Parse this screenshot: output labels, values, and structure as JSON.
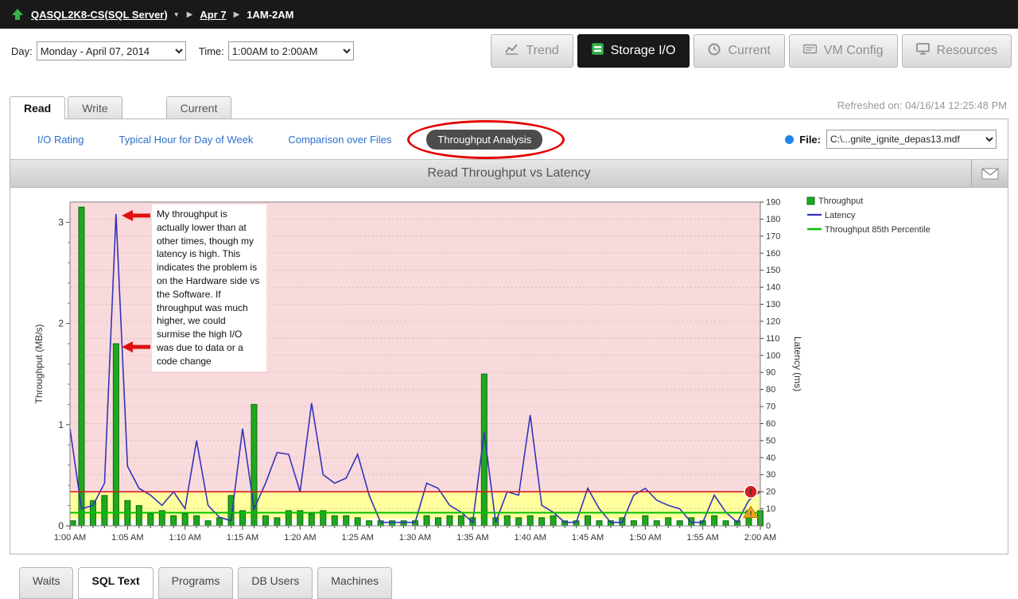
{
  "topbar": {
    "server": "QASQL2K8-CS(SQL Server)",
    "date": "Apr 7",
    "time_range": "1AM-2AM"
  },
  "toolbar": {
    "day_label": "Day:",
    "day_value": "Monday - April 07, 2014",
    "time_label": "Time:",
    "time_value": "1:00AM to 2:00AM",
    "nav": [
      {
        "label": "Trend"
      },
      {
        "label": "Storage I/O"
      },
      {
        "label": "Current"
      },
      {
        "label": "VM Config"
      },
      {
        "label": "Resources"
      }
    ]
  },
  "tabs": {
    "read": "Read",
    "write": "Write",
    "current": "Current",
    "refreshed": "Refreshed on: 04/16/14 12:25:48 PM"
  },
  "subnav": {
    "links": [
      {
        "label": "I/O Rating"
      },
      {
        "label": "Typical Hour for Day of Week"
      },
      {
        "label": "Comparison over Files"
      }
    ],
    "active_link": "Throughput Analysis",
    "file_label": "File:",
    "file_value": "C:\\...gnite_ignite_depas13.mdf"
  },
  "chart_data": {
    "type": "bar",
    "title": "Read Throughput vs Latency",
    "x_tick_labels": [
      "1:00 AM",
      "1:05 AM",
      "1:10 AM",
      "1:15 AM",
      "1:20 AM",
      "1:25 AM",
      "1:30 AM",
      "1:35 AM",
      "1:40 AM",
      "1:45 AM",
      "1:50 AM",
      "1:55 AM",
      "2:00 AM"
    ],
    "left_axis": {
      "label": "Throughput (MB/s)",
      "min": 0,
      "max": 3.2,
      "ticks": [
        0,
        1,
        2,
        3
      ],
      "minor_step": 0.2
    },
    "right_axis": {
      "label": "Latency (ms)",
      "min": 0,
      "max": 190,
      "tick_step": 10
    },
    "series": [
      {
        "name": "Throughput",
        "type": "bar",
        "axis": "left",
        "color": "#1fa81f",
        "values": [
          0.05,
          3.15,
          0.25,
          0.3,
          1.8,
          0.25,
          0.2,
          0.12,
          0.15,
          0.1,
          0.12,
          0.1,
          0.05,
          0.08,
          0.3,
          0.15,
          1.2,
          0.1,
          0.08,
          0.15,
          0.15,
          0.12,
          0.15,
          0.1,
          0.1,
          0.08,
          0.05,
          0.05,
          0.05,
          0.05,
          0.05,
          0.1,
          0.08,
          0.1,
          0.1,
          0.08,
          1.5,
          0.08,
          0.1,
          0.08,
          0.1,
          0.08,
          0.1,
          0.05,
          0.05,
          0.1,
          0.05,
          0.05,
          0.08,
          0.05,
          0.1,
          0.05,
          0.08,
          0.05,
          0.08,
          0.05,
          0.1,
          0.05,
          0.05,
          0.15,
          0.15
        ]
      },
      {
        "name": "Latency",
        "type": "line",
        "axis": "right",
        "color": "#3333bb",
        "values": [
          57,
          10,
          12,
          25,
          183,
          35,
          22,
          18,
          12,
          20,
          10,
          50,
          12,
          5,
          3,
          57,
          10,
          25,
          43,
          42,
          20,
          72,
          30,
          25,
          28,
          42,
          18,
          2,
          2,
          2,
          2,
          25,
          22,
          12,
          8,
          2,
          55,
          2,
          20,
          18,
          65,
          12,
          8,
          2,
          2,
          22,
          10,
          2,
          2,
          18,
          22,
          15,
          12,
          10,
          2,
          2,
          18,
          8,
          2,
          15,
          20
        ]
      },
      {
        "name": "Throughput 85th Percentile",
        "type": "hline",
        "axis": "left",
        "color": "#00c000",
        "value": 0.13
      }
    ],
    "thresholds": {
      "critical_latency_ms": 20,
      "warning_latency_ms": 4,
      "critical_color": "#d42020",
      "critical_bg": "#f9dadc",
      "warning_bg": "#ffff9e"
    },
    "legend": [
      "Throughput",
      "Latency",
      "Throughput 85th Percentile"
    ],
    "annotation": "My throughput is actually lower than at other times, though my latency is high. This indicates the problem is on the Hardware side vs the Software. If throughput was much higher, we could surmise the high I/O was due to data or a code change"
  },
  "bottom_tabs": [
    {
      "label": "Waits"
    },
    {
      "label": "SQL Text"
    },
    {
      "label": "Programs"
    },
    {
      "label": "DB Users"
    },
    {
      "label": "Machines"
    }
  ]
}
